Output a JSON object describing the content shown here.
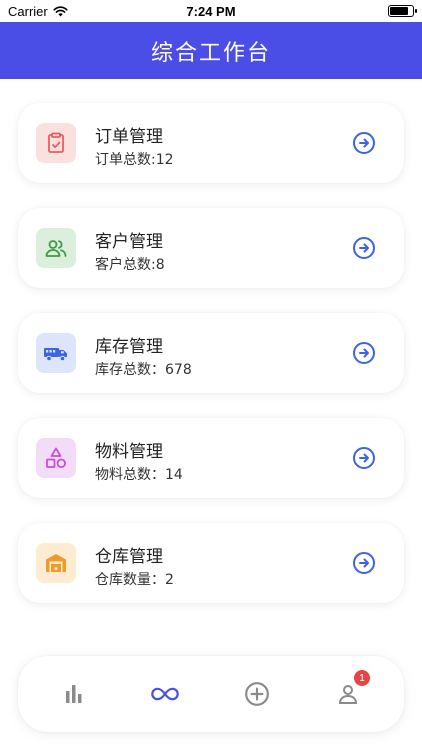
{
  "status_bar": {
    "carrier": "Carrier",
    "time": "7:24 PM"
  },
  "header": {
    "title": "综合工作台"
  },
  "cards": [
    {
      "title": "订单管理",
      "subtitle": "订单总数:12",
      "icon": "clipboard-check-icon",
      "icon_color": "#e85d5d",
      "icon_bg": "#fbe0e0"
    },
    {
      "title": "客户管理",
      "subtitle": "客户总数:8",
      "icon": "users-icon",
      "icon_color": "#3f9a4a",
      "icon_bg": "#dcefdc"
    },
    {
      "title": "库存管理",
      "subtitle": "库存总数：678",
      "icon": "truck-icon",
      "icon_color": "#3d63e0",
      "icon_bg": "#dde5fb"
    },
    {
      "title": "物料管理",
      "subtitle": "物料总数：14",
      "icon": "shapes-icon",
      "icon_color": "#c64fd9",
      "icon_bg": "#f3dcf7"
    },
    {
      "title": "仓库管理",
      "subtitle": "仓库数量：2",
      "icon": "warehouse-icon",
      "icon_color": "#f09b27",
      "icon_bg": "#fdebd2"
    }
  ],
  "arrow_color": "#3d63e0",
  "tab_bar": {
    "tabs": [
      {
        "icon": "bar-chart-icon",
        "active": false
      },
      {
        "icon": "infinity-icon",
        "active": true
      },
      {
        "icon": "plus-circle-icon",
        "active": false
      },
      {
        "icon": "user-icon",
        "active": false,
        "badge": "1"
      }
    ],
    "active_color": "#4b4ee6",
    "inactive_color": "#8a8a8a",
    "badge_color": "#e64545"
  }
}
